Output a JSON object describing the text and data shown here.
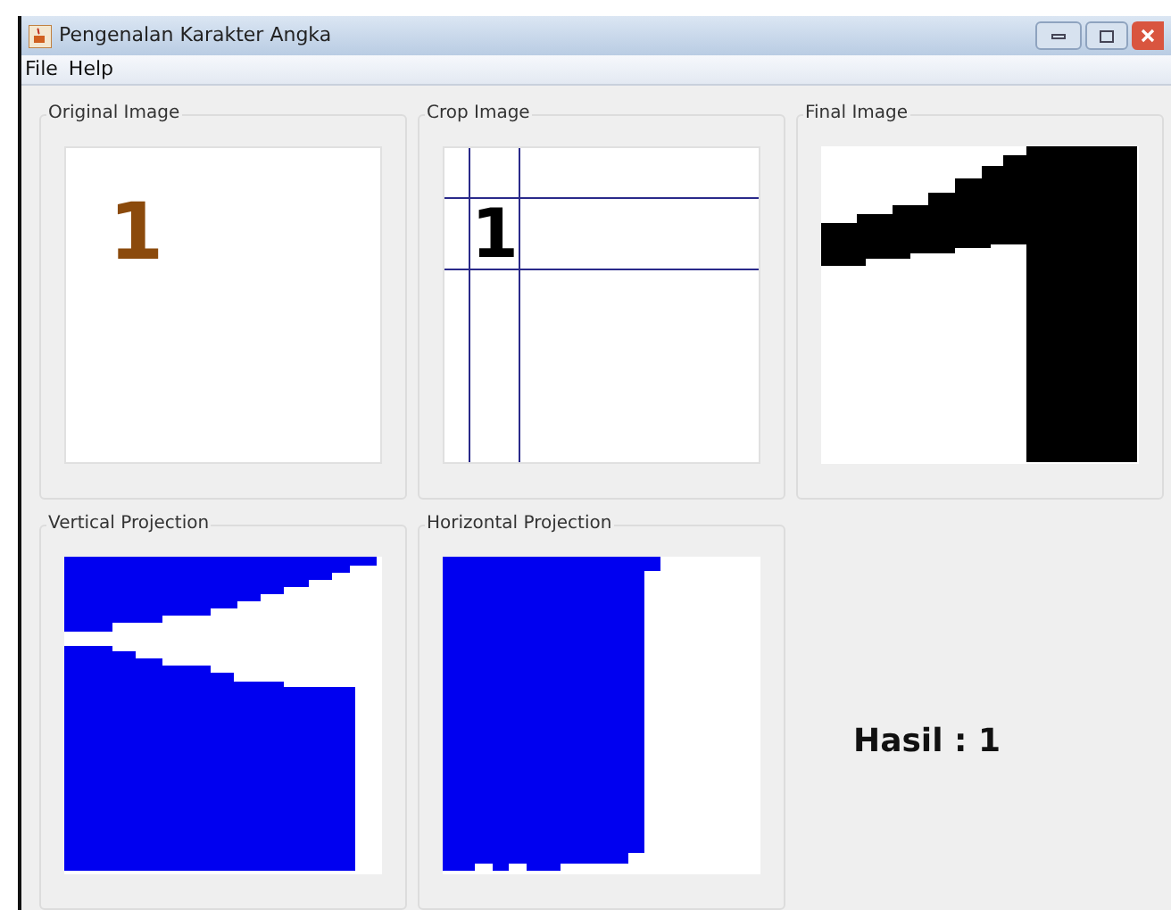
{
  "window": {
    "title": "Pengenalan Karakter Angka"
  },
  "menu": [
    "File",
    "Help"
  ],
  "panels": [
    {
      "title": "Original Image",
      "kind": "digit",
      "digit": "1",
      "color": "#8b4a0c"
    },
    {
      "title": "Crop Image",
      "kind": "crop",
      "digit": "1",
      "color": "#000000"
    },
    {
      "title": "Final Image",
      "kind": "bitmap"
    },
    {
      "title": "Vertical Projection",
      "kind": "vprojection"
    },
    {
      "title": "Horizontal Projection",
      "kind": "hprojection"
    }
  ],
  "result": "Hasil : 1"
}
